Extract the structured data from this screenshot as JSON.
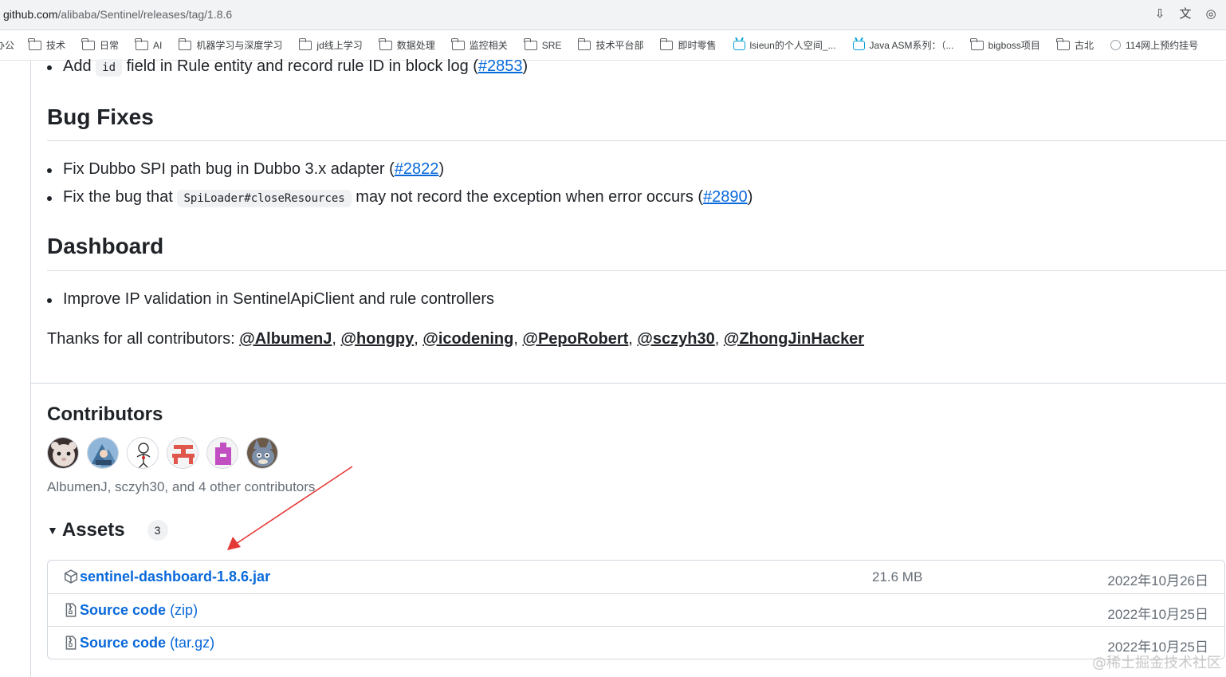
{
  "browser": {
    "url_host": "github.com",
    "url_path": "/alibaba/Sentinel/releases/tag/1.8.6",
    "toolbar_icons": [
      "install-app-icon",
      "translate-icon",
      "extension-icon"
    ]
  },
  "bookmarks": [
    {
      "label": "办公",
      "icon": "none"
    },
    {
      "label": "技术",
      "icon": "folder"
    },
    {
      "label": "日常",
      "icon": "folder"
    },
    {
      "label": "AI",
      "icon": "folder"
    },
    {
      "label": "机器学习与深度学习",
      "icon": "folder"
    },
    {
      "label": "jd线上学习",
      "icon": "folder"
    },
    {
      "label": "数据处理",
      "icon": "folder"
    },
    {
      "label": "监控相关",
      "icon": "folder"
    },
    {
      "label": "SRE",
      "icon": "folder"
    },
    {
      "label": "技术平台部",
      "icon": "folder"
    },
    {
      "label": "即时零售",
      "icon": "folder"
    },
    {
      "label": "lsieun的个人空间_...",
      "icon": "bilibili"
    },
    {
      "label": "Java ASM系列：（...",
      "icon": "bilibili"
    },
    {
      "label": "bigboss项目",
      "icon": "folder"
    },
    {
      "label": "古北",
      "icon": "folder"
    },
    {
      "label": "114网上预约挂号",
      "icon": "globe"
    }
  ],
  "release_notes": {
    "feature_item": {
      "prefix": "Add",
      "code": "id",
      "text": "field in Rule entity and record rule ID in block log (",
      "link": "#2853",
      "suffix": ")"
    },
    "bugfix_heading": "Bug Fixes",
    "bugfix_1": {
      "text": "Fix Dubbo SPI path bug in Dubbo 3.x adapter (",
      "link": "#2822",
      "suffix": ")"
    },
    "bugfix_2": {
      "prefix": "Fix the bug that",
      "code": "SpiLoader#closeResources",
      "text": "may not record the exception when error occurs (",
      "link": "#2890",
      "suffix": ")"
    },
    "dashboard_heading": "Dashboard",
    "dashboard_1": "Improve IP validation in SentinelApiClient and rule controllers",
    "thanks_prefix": "Thanks for all contributors:",
    "contributors": [
      "@AlbumenJ",
      "@hongpy",
      "@icodening",
      "@PepoRobert",
      "@sczyh30",
      "@ZhongJinHacker"
    ]
  },
  "contributors_section": {
    "title": "Contributors",
    "summary": "AlbumenJ, sczyh30, and 4 other contributors"
  },
  "assets": {
    "title": "Assets",
    "count": "3",
    "rows": [
      {
        "name": "sentinel-dashboard-1.8.6.jar",
        "ext": "",
        "size": "21.6 MB",
        "date": "2022年10月26日",
        "icon": "package-icon"
      },
      {
        "name": "Source code",
        "ext": "(zip)",
        "size": "",
        "date": "2022年10月25日",
        "icon": "file-zip-icon"
      },
      {
        "name": "Source code",
        "ext": "(tar.gz)",
        "size": "",
        "date": "2022年10月25日",
        "icon": "file-zip-icon"
      }
    ]
  },
  "annotation": {
    "color": "#e53935"
  },
  "watermark": "@稀土掘金技术社区",
  "colors": {
    "link": "#0969da",
    "text": "#1f2328",
    "muted": "#656d76",
    "border": "#d0d7de"
  }
}
